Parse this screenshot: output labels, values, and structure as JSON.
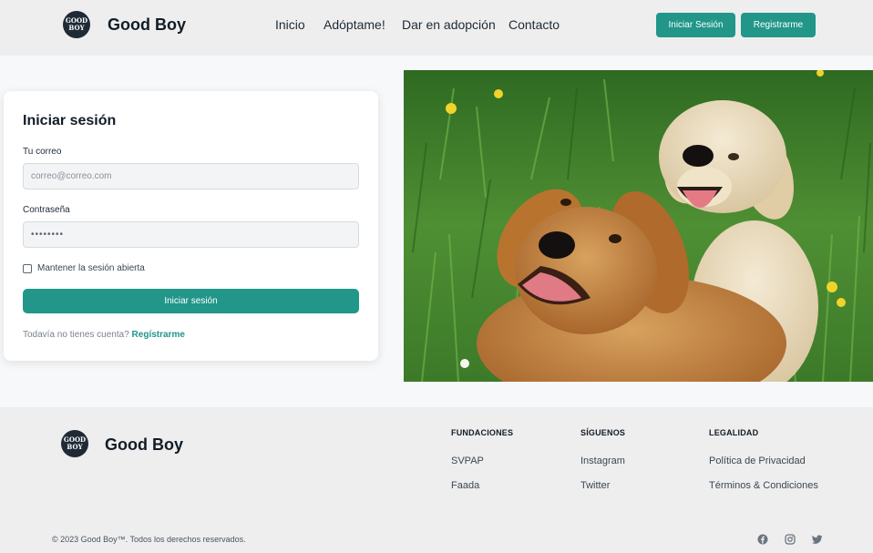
{
  "header": {
    "logo_line1": "GOOD",
    "logo_line2": "BOY",
    "brand": "Good Boy",
    "nav": [
      "Inicio",
      "Adóptame!",
      "Dar en adopción",
      "Contacto"
    ],
    "login_button": "Iniciar Sesión",
    "register_button": "Registrarme"
  },
  "login": {
    "title": "Iniciar sesión",
    "email_label": "Tu correo",
    "email_placeholder": "correo@correo.com",
    "password_label": "Contraseña",
    "password_value": "••••••••",
    "remember_label": "Mantener la sesión abierta",
    "remember_checked": false,
    "submit_label": "Iniciar sesión",
    "no_account_text": "Todavía no tienes cuenta?",
    "signup_link": "Regístrarme"
  },
  "footer": {
    "logo_line1": "GOOD",
    "logo_line2": "BOY",
    "brand": "Good Boy",
    "columns": [
      {
        "title": "FUNDACIONES",
        "links": [
          "SVPAP",
          "Faada"
        ]
      },
      {
        "title": "SÍGUENOS",
        "links": [
          "Instagram",
          "Twitter"
        ]
      },
      {
        "title": "LEGALIDAD",
        "links": [
          "Política de Privacidad",
          "Términos & Condiciones"
        ]
      }
    ],
    "copyright": "© 2023 Good Boy™. Todos los derechos reservados.",
    "social_icons": [
      "facebook-icon",
      "instagram-icon",
      "twitter-icon"
    ]
  },
  "colors": {
    "accent": "#219689",
    "dark": "#1f2a36",
    "header_bg": "#eeeeee"
  }
}
